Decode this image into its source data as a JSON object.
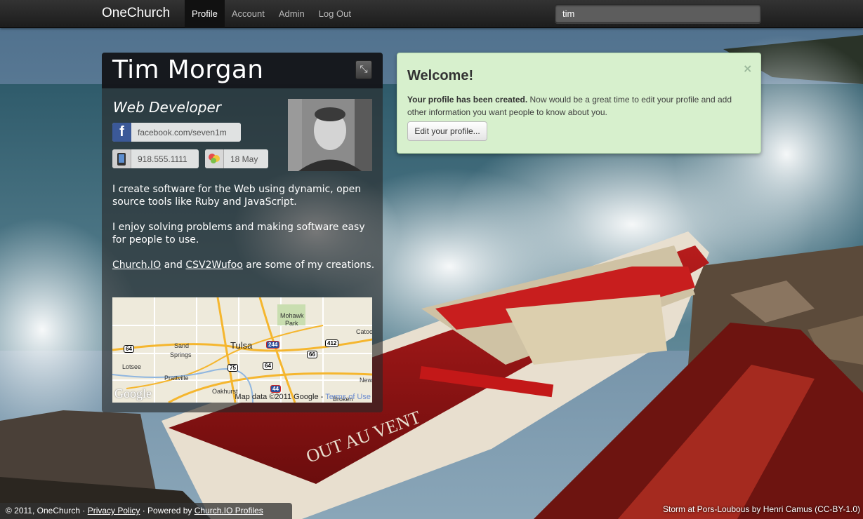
{
  "navbar": {
    "brand": "OneChurch",
    "items": [
      {
        "label": "Profile",
        "active": true
      },
      {
        "label": "Account",
        "active": false
      },
      {
        "label": "Admin",
        "active": false
      },
      {
        "label": "Log Out",
        "active": false
      }
    ],
    "search_value": "tim"
  },
  "profile": {
    "name": "Tim Morgan",
    "edit_icon": "resize-icon",
    "title": "Web Developer",
    "facebook": "facebook.com/seven1m",
    "phone": "918.555.1111",
    "birthday": "18 May",
    "bio": {
      "p1": "I create software for the Web using dynamic, open source tools like Ruby and JavaScript.",
      "p2": "I enjoy solving problems and making software easy for people to use.",
      "link1": "Church.IO",
      "and_text": " and ",
      "link2": "CSV2Wufoo",
      "p3_rest": " are some of my creations."
    },
    "map": {
      "labels": {
        "tulsa": "Tulsa",
        "mohawk": "Mohawk",
        "park": "Park",
        "sand": "Sand",
        "springs": "Springs",
        "lotsee": "Lotsee",
        "prattville": "Prattville",
        "oakhurst": "Oakhurst",
        "catoosa": "Catoo",
        "new": "New",
        "broken": "Broken"
      },
      "shields": [
        "64",
        "244",
        "412",
        "66",
        "75",
        "64",
        "44"
      ],
      "logo": "Google",
      "credit": "Map data ©2011 Google - ",
      "terms": "Terms of Use"
    }
  },
  "alert": {
    "title": "Welcome!",
    "close": "×",
    "bold": "Your profile has been created.",
    "text": " Now would be a great time to edit your profile and add other information you want people to know about you.",
    "button": "Edit your profile..."
  },
  "footer": {
    "copyright": "© 2011, OneChurch · ",
    "privacy": "Privacy Policy",
    "powered": " · Powered by ",
    "powered_link": "Church.IO Profiles"
  },
  "photo_credit": "Storm at Pors-Loubous by Henri Camus (CC-BY-1.0)",
  "background_text": "OUT AU VENT"
}
